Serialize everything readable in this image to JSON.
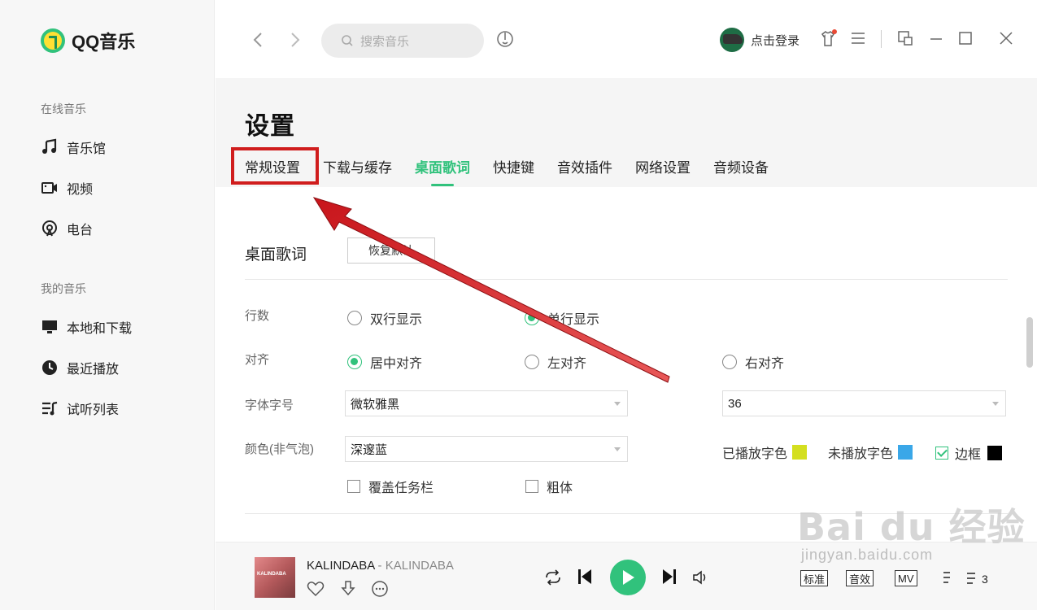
{
  "app": {
    "logo_text": "QQ音乐"
  },
  "sidebar": {
    "online_section": "在线音乐",
    "online_items": [
      {
        "label": "音乐馆",
        "icon": "music-note-icon"
      },
      {
        "label": "视频",
        "icon": "video-camera-icon"
      },
      {
        "label": "电台",
        "icon": "radio-icon"
      }
    ],
    "my_section": "我的音乐",
    "my_items": [
      {
        "label": "本地和下载",
        "icon": "monitor-icon"
      },
      {
        "label": "最近播放",
        "icon": "clock-icon"
      },
      {
        "label": "试听列表",
        "icon": "playlist-icon"
      }
    ]
  },
  "topbar": {
    "search_placeholder": "搜索音乐",
    "login_label": "点击登录"
  },
  "settings": {
    "title": "设置",
    "tabs": [
      "常规设置",
      "下载与缓存",
      "桌面歌词",
      "快捷键",
      "音效插件",
      "网络设置",
      "音频设备"
    ],
    "active_tab": "桌面歌词",
    "section_title": "桌面歌词",
    "reset_label": "恢复默认",
    "rows_label": "行数",
    "rows_options": [
      "双行显示",
      "单行显示"
    ],
    "rows_selected": "单行显示",
    "align_label": "对齐",
    "align_options": [
      "居中对齐",
      "左对齐",
      "右对齐"
    ],
    "align_selected": "居中对齐",
    "font_label": "字体字号",
    "font_value": "微软雅黑",
    "font_size_value": "36",
    "color_label": "颜色(非气泡)",
    "color_value": "深邃蓝",
    "played_color_label": "已播放字色",
    "played_color": "#d4df1f",
    "unplayed_color_label": "未播放字色",
    "unplayed_color": "#3aa7e8",
    "border_label": "边框",
    "border_color": "#000000",
    "border_checked": true,
    "cover_taskbar_label": "覆盖任务栏",
    "bold_label": "粗体"
  },
  "player": {
    "song_title": "KALINDABA",
    "separator": " - ",
    "artist": "KALINDABA",
    "cover_text": "KALINDABA",
    "accent": "#31c27c"
  },
  "watermark": {
    "text": "Bai du 经验",
    "sub": "jingyan.baidu.com"
  }
}
